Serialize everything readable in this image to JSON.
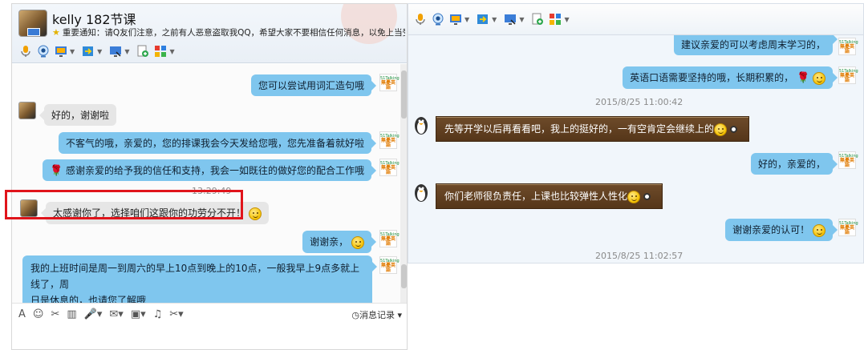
{
  "left_window": {
    "contact_name": "kelly 182节课",
    "notice": "重要通知：请Q友们注意，之前有人恶意盗取我QQ，希望大家不要相信任何消息，以免上当受...",
    "messages": [
      {
        "side": "right",
        "text": "您可以尝试用词汇造句哦"
      },
      {
        "side": "left",
        "text": "好的，谢谢啦"
      },
      {
        "side": "right",
        "text": "不客气的哦，亲爱的，您的排课我会今天发给您哦，您先准备着就好啦"
      },
      {
        "side": "right",
        "text": "感谢亲爱的给予我的信任和支持，我会一如既往的做好您的配合工作哦"
      },
      {
        "side": "time",
        "text": "13:29:49"
      },
      {
        "side": "left",
        "text": "太感谢你了，选择咱们这跟你的功劳分不开！"
      },
      {
        "side": "right",
        "text": "谢谢亲，"
      },
      {
        "side": "right",
        "line1": "我的上班时间是周一到周六的早上10点到晚上的10点，一般我早上9点多就上线了，周",
        "line2": "日是休息的，也请您了解哦"
      }
    ],
    "input_tools": [
      "A",
      "☺",
      "✂",
      "▥",
      "🎤▾",
      "✉▾",
      "▣▾",
      "♫",
      "✂▾"
    ],
    "history_label": "消息记录"
  },
  "right_window": {
    "messages": [
      {
        "side": "right",
        "text": "建议亲爱的可以考虑周末学习的，"
      },
      {
        "side": "right",
        "text": "英语口语需要坚持的哦，长期积累的，"
      },
      {
        "side": "time",
        "text": "2015/8/25 11:00:42"
      },
      {
        "side": "left",
        "text": "先等开学以后再看看吧，我上的挺好的，一有空肯定会继续上的"
      },
      {
        "side": "right",
        "text": "好的，亲爱的，"
      },
      {
        "side": "left",
        "text": "你们老师很负责任，上课也比较弹性人性化"
      },
      {
        "side": "right",
        "text": "谢谢亲爱的认可！"
      },
      {
        "side": "time",
        "text": "2015/8/25 11:02:57"
      }
    ]
  },
  "brand_logo_text": {
    "top": "51Talking",
    "bottom": "無憂英語"
  },
  "colors": {
    "bubble_blue": "#7fc6ee",
    "highlight_red": "#e0141b",
    "brown_button": "#6e4b2a"
  }
}
